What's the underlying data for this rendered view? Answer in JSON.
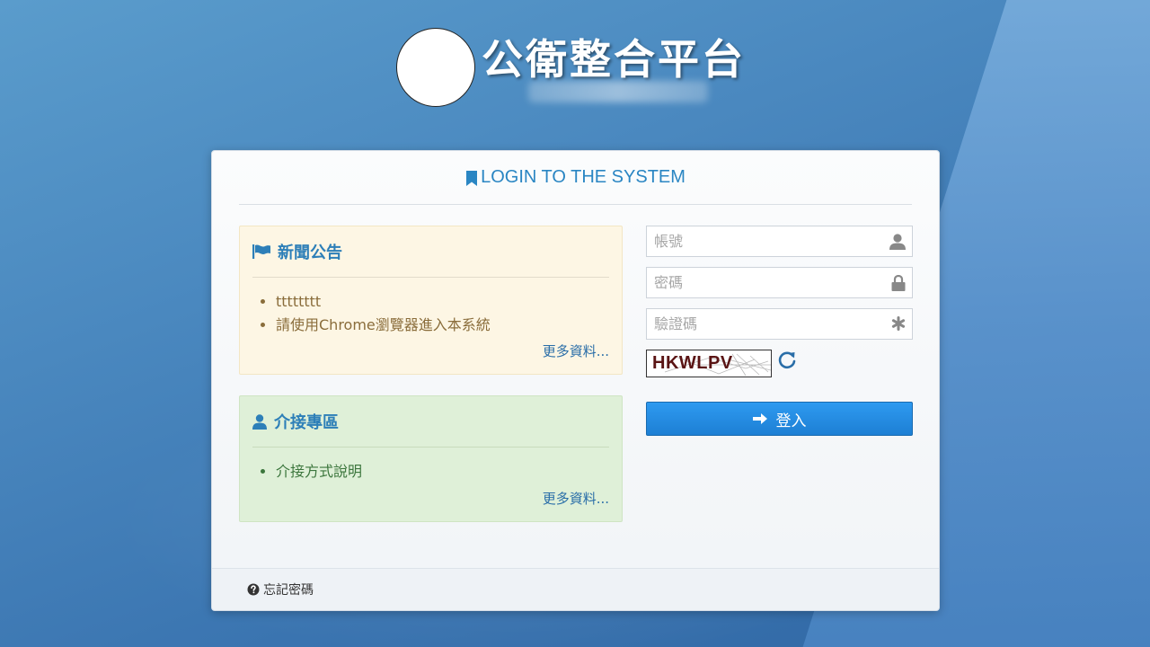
{
  "header": {
    "title": "公衛整合平台"
  },
  "login": {
    "heading": "LOGIN TO THE SYSTEM",
    "username_placeholder": "帳號",
    "password_placeholder": "密碼",
    "captcha_placeholder": "驗證碼",
    "captcha_text": "HKWLPV",
    "submit_label": "登入",
    "forgot_label": "忘記密碼"
  },
  "news": {
    "title": "新聞公告",
    "items": [
      "tttttttt",
      "請使用Chrome瀏覽器進入本系統"
    ],
    "more_label": "更多資料..."
  },
  "interface": {
    "title": "介接專區",
    "items": [
      "介接方式說明"
    ],
    "more_label": "更多資料..."
  },
  "colors": {
    "accent": "#2a86c3",
    "button": "#1d7fd4",
    "news_bg": "#fdf6e4",
    "news_text": "#8a6d3b",
    "interface_bg": "#dff0d8",
    "interface_text": "#3c763d"
  },
  "icons": {
    "heading": "bookmark-icon",
    "news": "flag-icon",
    "interface": "user-icon",
    "username": "user-icon",
    "password": "lock-icon",
    "captcha": "asterisk-icon",
    "refresh": "refresh-icon",
    "submit": "arrow-right-icon",
    "forgot": "question-circle-icon"
  }
}
